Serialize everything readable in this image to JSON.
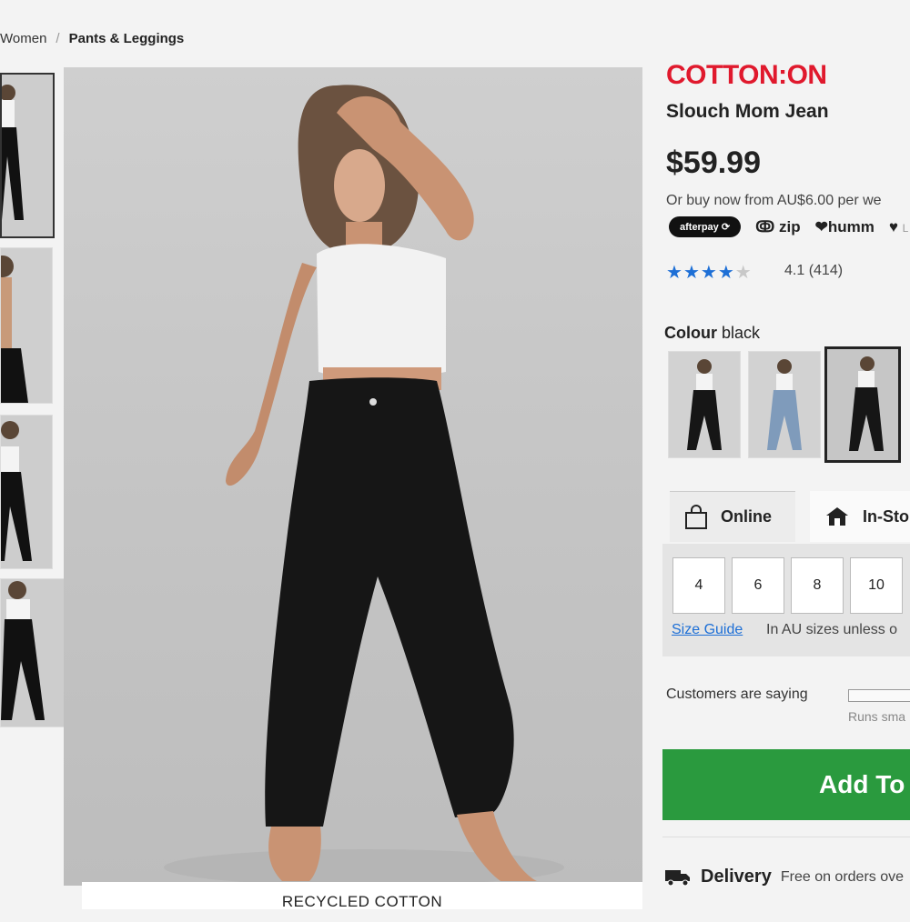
{
  "breadcrumb": {
    "parent": "Women",
    "separator": "/",
    "current": "Pants & Leggings"
  },
  "brand": "COTTON:ON",
  "product": {
    "name": "Slouch Mom Jean",
    "price": "$59.99",
    "buy_now_text": "Or buy now from AU$6.00 per we",
    "payment_options": [
      "afterpay",
      "zip",
      "humm",
      "L"
    ],
    "rating": {
      "stars": 4.1,
      "max": 5,
      "text": "4.1 (414)"
    },
    "colour_label": "Colour",
    "colour_value": "black",
    "caption": "RECYCLED COTTON"
  },
  "fulfilment_tabs": [
    {
      "label": "Online",
      "icon": "shopping-bag-icon",
      "active": true
    },
    {
      "label": "In-Sto",
      "icon": "store-icon",
      "active": false
    }
  ],
  "sizes": [
    "4",
    "6",
    "8",
    "10"
  ],
  "size_guide": "Size Guide",
  "size_note": "In AU sizes unless o",
  "customers_saying": "Customers are saying",
  "runs_small": "Runs sma",
  "add_to_bag": "Add To",
  "delivery": {
    "label": "Delivery",
    "text": "Free on orders ove"
  },
  "colors": {
    "brand": "#e0192d",
    "add_button": "#2a9a3e",
    "star": "#1d6fd6"
  }
}
